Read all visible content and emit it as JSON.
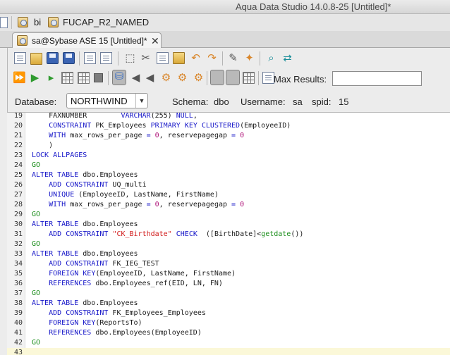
{
  "window": {
    "title": "Aqua Data Studio 14.0.8-25 [Untitled]*"
  },
  "breadcrumb": {
    "items": [
      "bi",
      "FUCAP_R2_NAMED"
    ]
  },
  "tab": {
    "label": "sa@Sybase ASE 15 [Untitled]*",
    "close": "✕"
  },
  "toolbar": {
    "max_results_label": "Max Results:",
    "max_results_value": ""
  },
  "connection": {
    "database_label": "Database:",
    "database_value": "NORTHWIND",
    "schema_label": "Schema:",
    "schema_value": "dbo",
    "username_label": "Username:",
    "username_value": "sa",
    "spid_label": "spid:",
    "spid_value": "15"
  },
  "editor": {
    "lines": [
      {
        "n": "19",
        "text": "    FAXNUMBER        VARCHAR(255) NULL,"
      },
      {
        "n": "20",
        "text": "    CONSTRAINT PK_Employees PRIMARY KEY CLUSTERED(EmployeeID)"
      },
      {
        "n": "21",
        "text": "    WITH max_rows_per_page = 0, reservepagegap = 0"
      },
      {
        "n": "22",
        "text": "    )"
      },
      {
        "n": "23",
        "text": "LOCK ALLPAGES"
      },
      {
        "n": "24",
        "text": "GO"
      },
      {
        "n": "25",
        "text": "ALTER TABLE dbo.Employees"
      },
      {
        "n": "26",
        "text": "    ADD CONSTRAINT UQ_multi"
      },
      {
        "n": "27",
        "text": "    UNIQUE (EmployeeID, LastName, FirstName)"
      },
      {
        "n": "28",
        "text": "    WITH max_rows_per_page = 0, reservepagegap = 0"
      },
      {
        "n": "29",
        "text": "GO"
      },
      {
        "n": "30",
        "text": "ALTER TABLE dbo.Employees"
      },
      {
        "n": "31",
        "text": "    ADD CONSTRAINT \"CK_Birthdate\" CHECK  ([BirthDate]<getdate())"
      },
      {
        "n": "32",
        "text": "GO"
      },
      {
        "n": "33",
        "text": "ALTER TABLE dbo.Employees"
      },
      {
        "n": "34",
        "text": "    ADD CONSTRAINT FK_IEG_TEST"
      },
      {
        "n": "35",
        "text": "    FOREIGN KEY(EmployeeID, LastName, FirstName)"
      },
      {
        "n": "36",
        "text": "    REFERENCES dbo.Employees_ref(EID, LN, FN)"
      },
      {
        "n": "37",
        "text": "GO"
      },
      {
        "n": "38",
        "text": "ALTER TABLE dbo.Employees"
      },
      {
        "n": "39",
        "text": "    ADD CONSTRAINT FK_Employees_Employees"
      },
      {
        "n": "40",
        "text": "    FOREIGN KEY(ReportsTo)"
      },
      {
        "n": "41",
        "text": "    REFERENCES dbo.Employees(EmployeeID)"
      },
      {
        "n": "42",
        "text": "GO"
      },
      {
        "n": "43",
        "text": ""
      }
    ]
  },
  "colors": {
    "keyword": "#1515c8",
    "string": "#d11a1a",
    "number": "#b0157a",
    "function": "#1b8e1b",
    "current_line": "#fbf8d8"
  },
  "icons": [
    "new-file-icon",
    "open-folder-icon",
    "save-icon",
    "save-all-icon",
    "print-icon",
    "select-icon",
    "cut-icon",
    "copy-icon",
    "paste-icon",
    "undo-icon",
    "redo-icon",
    "format-icon",
    "wand-icon",
    "find-icon",
    "replace-icon",
    "execute-all-icon",
    "execute-icon",
    "execute-selected-icon",
    "explain-icon",
    "stop-icon",
    "pause-icon",
    "commit-icon",
    "rollback-icon",
    "results-grid-icon",
    "results-text-icon",
    "history-icon",
    "page-icon"
  ]
}
